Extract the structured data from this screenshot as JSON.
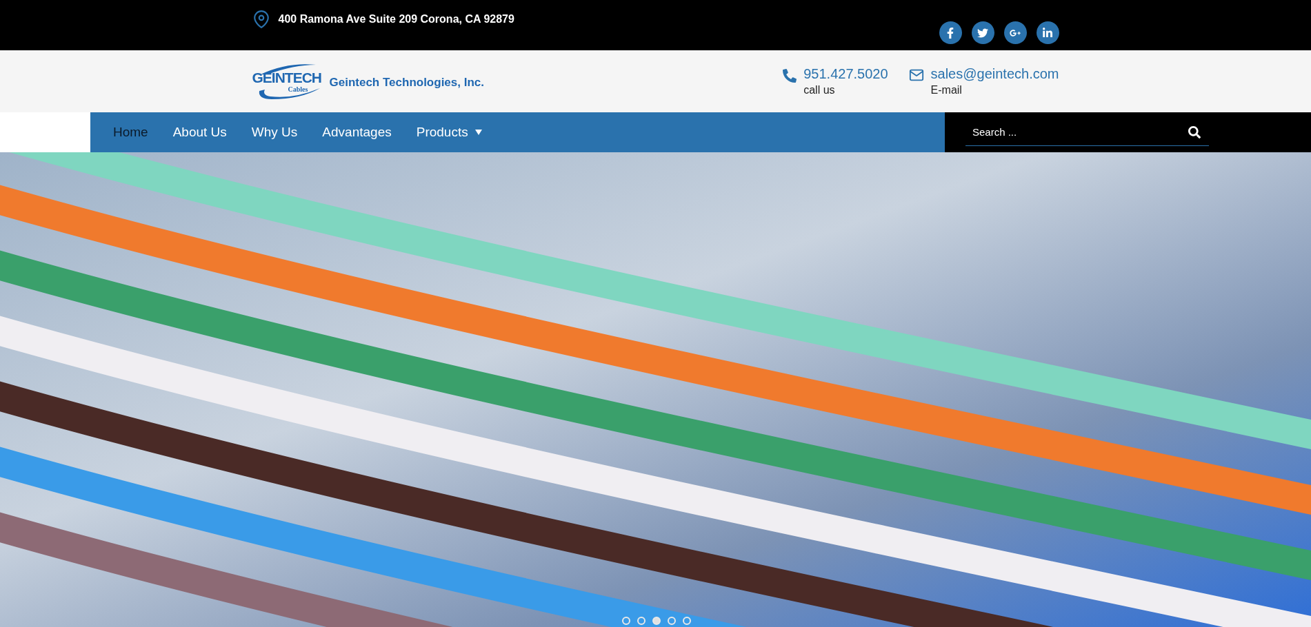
{
  "top_bar": {
    "address": "400 Ramona Ave Suite 209 Corona, CA 92879",
    "social": [
      {
        "kind": "facebook"
      },
      {
        "kind": "twitter"
      },
      {
        "kind": "googleplus"
      },
      {
        "kind": "linkedin"
      }
    ]
  },
  "header": {
    "logo": {
      "mark": "GEINTECH",
      "sub": "Cables",
      "name": "Geintech Technologies, Inc."
    },
    "contacts": [
      {
        "kind": "phone",
        "value": "951.427.5020",
        "label": "call us"
      },
      {
        "kind": "email",
        "value": "sales@geintech.com",
        "label": "E-mail"
      }
    ]
  },
  "nav": {
    "items": [
      {
        "label": "Home",
        "selected": true,
        "dropdown": false
      },
      {
        "label": "About Us",
        "selected": false,
        "dropdown": false
      },
      {
        "label": "Why Us",
        "selected": false,
        "dropdown": false
      },
      {
        "label": "Advantages",
        "selected": false,
        "dropdown": false
      },
      {
        "label": "Products",
        "selected": false,
        "dropdown": true
      }
    ],
    "search": {
      "placeholder": "Search ..."
    }
  },
  "slider": {
    "dots": [
      {
        "selected": false
      },
      {
        "selected": false
      },
      {
        "selected": true
      },
      {
        "selected": false
      },
      {
        "selected": false
      }
    ]
  }
}
